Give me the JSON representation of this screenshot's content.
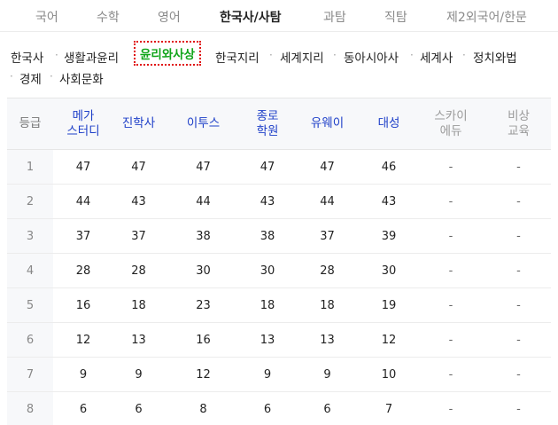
{
  "top_tabs": [
    {
      "label": "국어",
      "active": false
    },
    {
      "label": "수학",
      "active": false
    },
    {
      "label": "영어",
      "active": false
    },
    {
      "label": "한국사/사탐",
      "active": true
    },
    {
      "label": "과탐",
      "active": false
    },
    {
      "label": "직탐",
      "active": false
    },
    {
      "label": "제2외국어/한문",
      "active": false
    }
  ],
  "sub_tabs": [
    {
      "label": "한국사",
      "active": false
    },
    {
      "label": "생활과윤리",
      "active": false
    },
    {
      "label": "윤리와사상",
      "active": true
    },
    {
      "label": "한국지리",
      "active": false
    },
    {
      "label": "세계지리",
      "active": false
    },
    {
      "label": "동아시아사",
      "active": false
    },
    {
      "label": "세계사",
      "active": false
    },
    {
      "label": "정치와법",
      "active": false
    },
    {
      "label": "경제",
      "active": false
    },
    {
      "label": "사회문화",
      "active": false
    }
  ],
  "colors": {
    "accent_blue": "#1e3fc8",
    "active_green": "#10a51a",
    "highlight_red": "#e01010"
  },
  "table": {
    "headers": [
      {
        "line1": "등급",
        "line2": "",
        "style": "grade-col"
      },
      {
        "line1": "메가",
        "line2": "스터디",
        "style": "blue"
      },
      {
        "line1": "진학사",
        "line2": "",
        "style": "blue"
      },
      {
        "line1": "이투스",
        "line2": "",
        "style": "blue"
      },
      {
        "line1": "종로",
        "line2": "학원",
        "style": "blue"
      },
      {
        "line1": "유웨이",
        "line2": "",
        "style": "blue"
      },
      {
        "line1": "대성",
        "line2": "",
        "style": "blue"
      },
      {
        "line1": "스카이",
        "line2": "에듀",
        "style": "gray"
      },
      {
        "line1": "비상",
        "line2": "교육",
        "style": "gray"
      }
    ],
    "rows": [
      [
        "1",
        "47",
        "47",
        "47",
        "47",
        "47",
        "46",
        "-",
        "-"
      ],
      [
        "2",
        "44",
        "43",
        "44",
        "43",
        "44",
        "43",
        "-",
        "-"
      ],
      [
        "3",
        "37",
        "37",
        "38",
        "38",
        "37",
        "39",
        "-",
        "-"
      ],
      [
        "4",
        "28",
        "28",
        "30",
        "30",
        "28",
        "30",
        "-",
        "-"
      ],
      [
        "5",
        "16",
        "18",
        "23",
        "18",
        "18",
        "19",
        "-",
        "-"
      ],
      [
        "6",
        "12",
        "13",
        "16",
        "13",
        "13",
        "12",
        "-",
        "-"
      ],
      [
        "7",
        "9",
        "9",
        "12",
        "9",
        "9",
        "10",
        "-",
        "-"
      ],
      [
        "8",
        "6",
        "6",
        "8",
        "6",
        "6",
        "7",
        "-",
        "-"
      ]
    ]
  }
}
